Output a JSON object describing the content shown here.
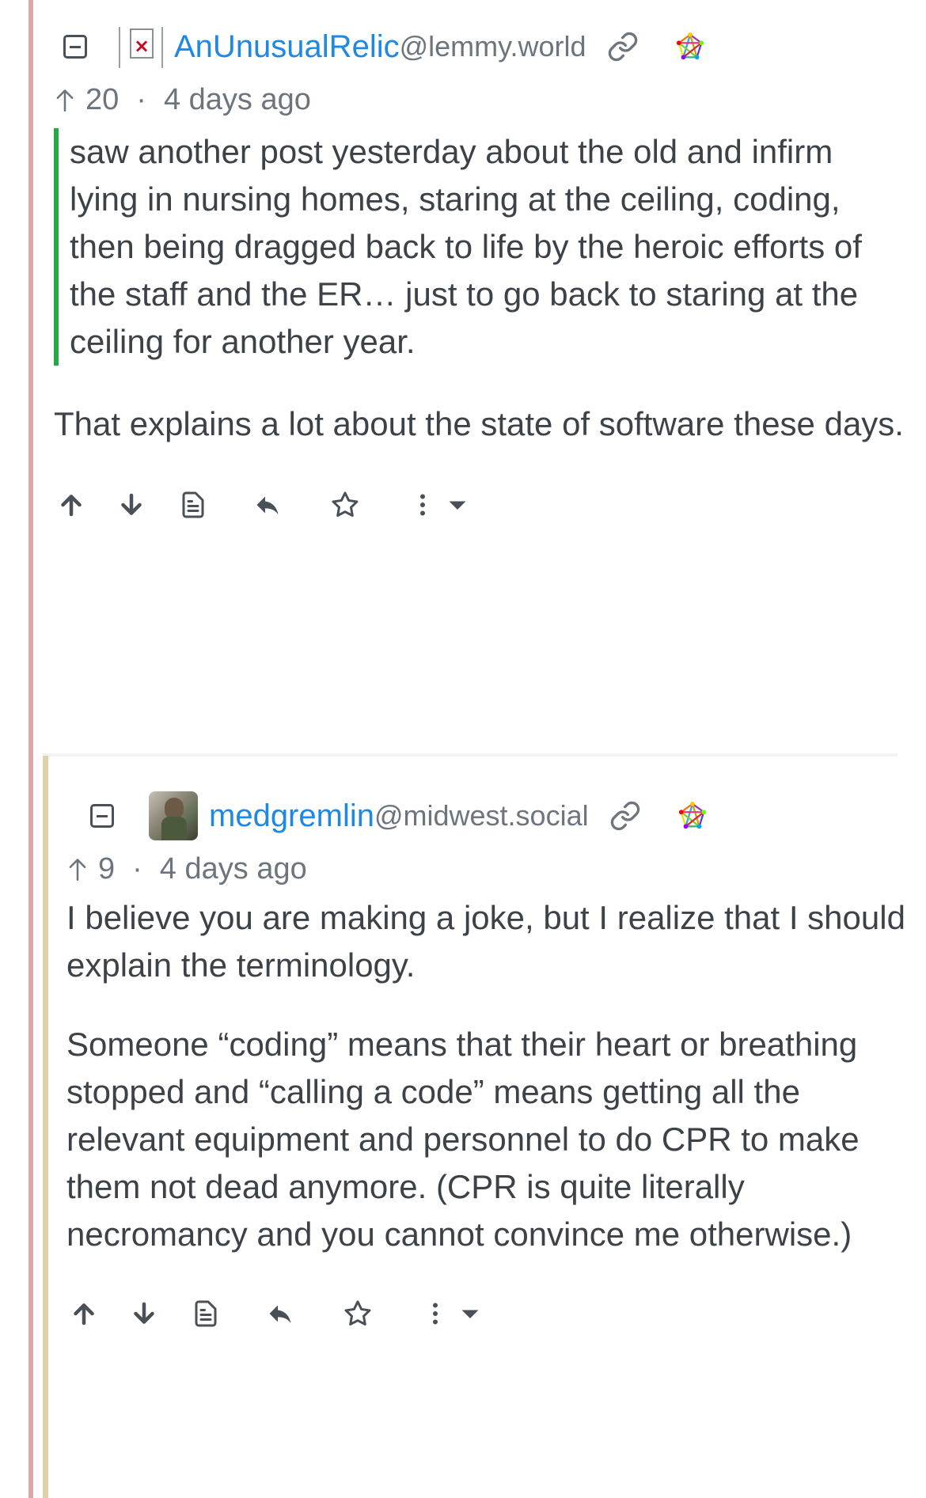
{
  "comments": [
    {
      "user": "AnUnusualRelic",
      "instance": "@lemmy.world",
      "score": "20",
      "time": "4 days ago",
      "quote": "saw another post yesterday about the old and infirm lying in nursing homes, staring at the ceiling, coding, then being dragged back to life by the heroic efforts of the staff and the ER… just to go back to staring at the ceiling for another year.",
      "paragraphs": [
        "That explains a lot about the state of software these days."
      ]
    },
    {
      "user": "medgremlin",
      "instance": "@midwest.social",
      "score": "9",
      "time": "4 days ago",
      "paragraphs": [
        "I believe you are making a joke, but I realize that I should explain the terminology.",
        "Someone “coding” means that their heart or breathing stopped and “calling a code” means getting all the relevant equipment and personnel to do CPR to make them not dead anymore. (CPR is quite literally necromancy and you cannot convince me otherwise.)"
      ]
    }
  ],
  "separator": "·",
  "icons": {
    "collapse": "minus-square-icon",
    "link": "link-icon",
    "fediverse": "fediverse-icon",
    "upvote": "arrow-up-icon",
    "downvote": "arrow-down-icon",
    "source": "file-text-icon",
    "reply": "reply-icon",
    "save": "star-icon",
    "more": "more-vertical-icon",
    "dropdown": "caret-down-icon"
  },
  "colors": {
    "username": "#1e88e5",
    "quote_border": "#28a745",
    "rail_outer": "#d8a9a9",
    "rail_inner": "#dcd4a8"
  }
}
